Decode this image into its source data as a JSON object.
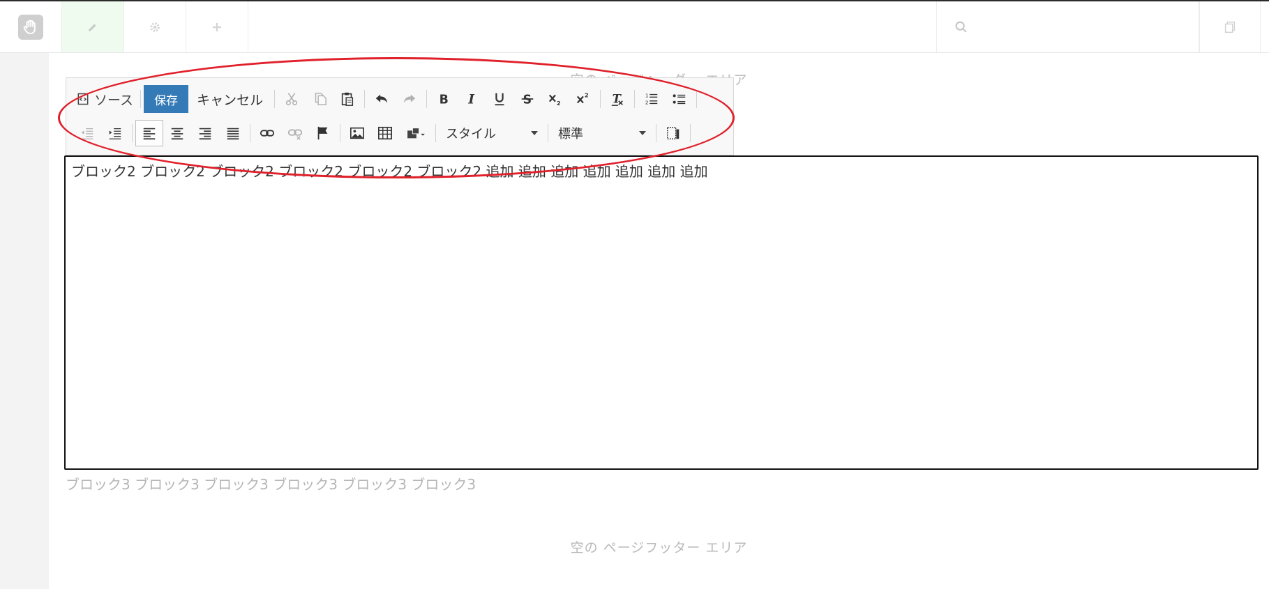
{
  "topbar": {
    "logo_icon": "hand-logo-icon",
    "edit_icon": "pencil-icon",
    "settings_icon": "gear-icon",
    "add_icon": "plus-icon",
    "search_icon": "search-icon",
    "pages_icon": "pages-icon"
  },
  "page": {
    "header_area": "空の ページヘッダー エリア",
    "footer_area": "空の ページフッター エリア"
  },
  "toolbar": {
    "source_label": "ソース",
    "save_label": "保存",
    "cancel_label": "キャンセル",
    "style_combo": "スタイル",
    "format_combo": "標準"
  },
  "editor": {
    "content": "ブロック2 ブロック2 ブロック2 ブロック2 ブロック2 ブロック2 追加 追加 追加 追加 追加 追加 追加"
  },
  "block3": {
    "text": "ブロック3 ブロック3 ブロック3 ブロック3 ブロック3 ブロック3"
  },
  "colors": {
    "accent": "#337ab7",
    "annotation": "#e0202a"
  }
}
